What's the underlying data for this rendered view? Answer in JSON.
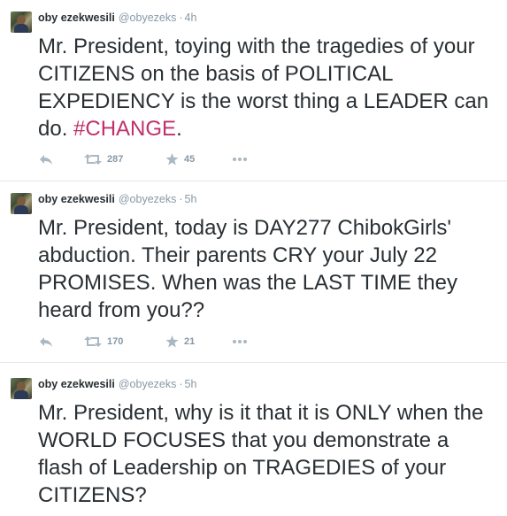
{
  "tweets": [
    {
      "fullname": "oby ezekwesili",
      "username": "@obyezeks",
      "time": "4h",
      "text_parts": [
        "Mr. President, toying with the tragedies of your CITIZENS on the basis of POLITICAL EXPEDIENCY is the worst thing a LEADER can do. ",
        "#CHANGE",
        "."
      ],
      "retweets": "287",
      "favorites": "45"
    },
    {
      "fullname": "oby ezekwesili",
      "username": "@obyezeks",
      "time": "5h",
      "text": "Mr. President, today is DAY277 ChibokGirls' abduction. Their parents CRY your July 22 PROMISES. When was the LAST TIME they heard from you??",
      "retweets": "170",
      "favorites": "21"
    },
    {
      "fullname": "oby ezekwesili",
      "username": "@obyezeks",
      "time": "5h",
      "text": "Mr. President, why is it that it is ONLY when the WORLD FOCUSES that you demonstrate a flash of Leadership on TRAGEDIES of your CITIZENS?"
    }
  ],
  "separator": "·",
  "icons": [
    "reply-icon",
    "retweet-icon",
    "favorite-star-icon",
    "more-dots-icon"
  ],
  "colors": {
    "hashtag": "#c0306a",
    "meta": "#8899a6",
    "text": "#292f33"
  }
}
